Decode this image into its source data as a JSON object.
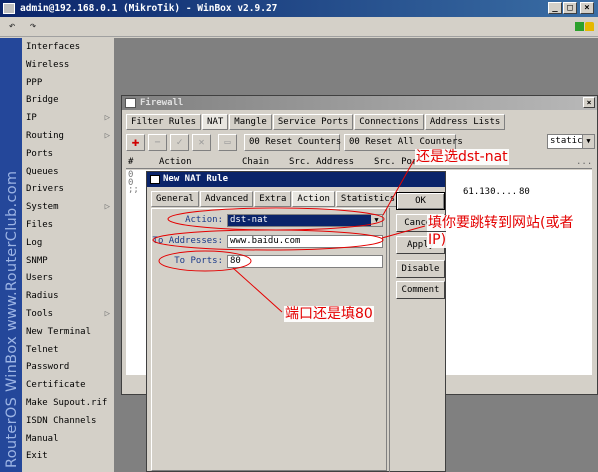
{
  "window": {
    "title": "admin@192.168.0.1 (MikroTik) - WinBox v2.9.27",
    "minimize": "_",
    "maximize": "□",
    "close": "×"
  },
  "toolbar": {
    "undo_icon": "↶",
    "redo_icon": "↷"
  },
  "brand": {
    "text": "RouterOS WinBox   www.RouterClub.com"
  },
  "sidebar": {
    "items": [
      {
        "label": "Interfaces",
        "arrow": ""
      },
      {
        "label": "Wireless",
        "arrow": ""
      },
      {
        "label": "PPP",
        "arrow": ""
      },
      {
        "label": "Bridge",
        "arrow": ""
      },
      {
        "label": "IP",
        "arrow": "▷"
      },
      {
        "label": "Routing",
        "arrow": "▷"
      },
      {
        "label": "Ports",
        "arrow": ""
      },
      {
        "label": "Queues",
        "arrow": ""
      },
      {
        "label": "Drivers",
        "arrow": ""
      },
      {
        "label": "System",
        "arrow": "▷"
      },
      {
        "label": "Files",
        "arrow": ""
      },
      {
        "label": "Log",
        "arrow": ""
      },
      {
        "label": "SNMP",
        "arrow": ""
      },
      {
        "label": "Users",
        "arrow": ""
      },
      {
        "label": "Radius",
        "arrow": ""
      },
      {
        "label": "Tools",
        "arrow": "▷"
      },
      {
        "label": "New Terminal",
        "arrow": ""
      },
      {
        "label": "Telnet",
        "arrow": ""
      },
      {
        "label": "Password",
        "arrow": ""
      },
      {
        "label": "Certificate",
        "arrow": ""
      },
      {
        "label": "Make Supout.rif",
        "arrow": ""
      },
      {
        "label": "ISDN Channels",
        "arrow": ""
      },
      {
        "label": "Manual",
        "arrow": ""
      },
      {
        "label": "Exit",
        "arrow": ""
      }
    ]
  },
  "firewall": {
    "title": "Firewall",
    "close": "×",
    "tabs": [
      "Filter Rules",
      "NAT",
      "Mangle",
      "Service Ports",
      "Connections",
      "Address Lists"
    ],
    "reset_counters": "00 Reset Counters",
    "reset_all_counters": "00 Reset All Counters",
    "chain_filter": "static",
    "more": "...",
    "columns": [
      "#",
      "Action",
      "Chain",
      "Src. Address",
      "Src. Port"
    ],
    "row_index": "0",
    "row_index2": "0",
    "row_marks": ";;",
    "row_value_1": "61.130....",
    "row_value_2": "80"
  },
  "nat_dialog": {
    "title": "New NAT Rule",
    "tabs": [
      "General",
      "Advanced",
      "Extra",
      "Action",
      "Statistics"
    ],
    "action_label": "Action:",
    "action_value": "dst-nat",
    "to_addresses_label": "To Addresses:",
    "to_addresses_value": "www.baidu.com",
    "to_ports_label": "To Ports:",
    "to_ports_value": "80",
    "buttons": {
      "ok": "OK",
      "cancel": "Cancel",
      "apply": "Apply",
      "disable": "Disable",
      "comment": "Comment"
    }
  },
  "annotations": {
    "a1": "还是选dst-nat",
    "a2": "填你要跳转到网站(或者",
    "a2b": "IP)",
    "a3": "端口还是填80"
  },
  "colors": {
    "annotation": "#e40000",
    "title_active": "#0a246a",
    "brand_strip": "#24479a"
  }
}
